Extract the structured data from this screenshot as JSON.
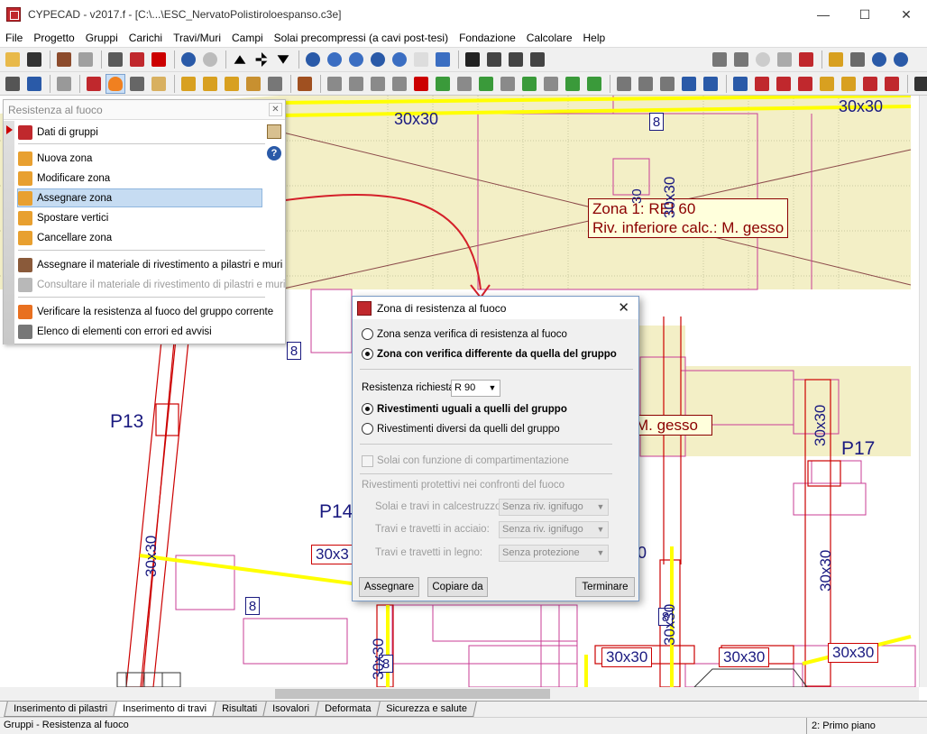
{
  "window": {
    "title": "CYPECAD - v2017.f - [C:\\...\\ESC_NervatoPolistiroloespanso.c3e]",
    "minimize": "—",
    "maximize": "☐",
    "close": "✕"
  },
  "menu": [
    "File",
    "Progetto",
    "Gruppi",
    "Carichi",
    "Travi/Muri",
    "Campi",
    "Solai precompressi (a cavi post-tesi)",
    "Fondazione",
    "Calcolare",
    "Help"
  ],
  "panel": {
    "title": "Resistenza al fuoco",
    "close": "✕",
    "items": [
      {
        "label": "Dati di gruppi"
      },
      {
        "label": "Nuova zona"
      },
      {
        "label": "Modificare zona"
      },
      {
        "label": "Assegnare zona"
      },
      {
        "label": "Spostare vertici"
      },
      {
        "label": "Cancellare zona"
      },
      {
        "label": "Assegnare il materiale di rivestimento a pilastri e muri"
      },
      {
        "label": "Consultare il materiale di rivestimento di pilastri e muri"
      },
      {
        "label": "Verificare la resistenza al fuoco del gruppo corrente"
      },
      {
        "label": "Elenco di elementi con errori ed avvisi"
      }
    ],
    "help": "?"
  },
  "dialog": {
    "title": "Zona di resistenza al fuoco",
    "close": "✕",
    "opt_no_check": "Zona senza verifica di resistenza al fuoco",
    "opt_diff_check": "Zona con verifica differente da quella del gruppo",
    "required_label": "Resistenza richiesta",
    "required_value": "R 90",
    "coat_same": "Rivestimenti uguali a quelli del gruppo",
    "coat_diff": "Rivestimenti diversi da quelli del gruppo",
    "compart": "Solai con funzione di compartimentazione",
    "protective_title": "Rivestimenti protettivi nei confronti del fuoco",
    "rows": [
      {
        "label": "Solai e travi in calcestruzzo:",
        "value": "Senza riv. ignifugo"
      },
      {
        "label": "Travi e travetti in acciaio:",
        "value": "Senza riv. ignifugo"
      },
      {
        "label": "Travi e travetti in legno:",
        "value": "Senza protezione"
      }
    ],
    "btn_assign": "Assegnare",
    "btn_copy": "Copiare da",
    "btn_end": "Terminare"
  },
  "canvas": {
    "zone_tag_line1": "Zona 1: REI 60",
    "zone_tag_line2": "Riv. inferiore calc.: M. gesso",
    "zone_tag_partial": "M. gesso",
    "beam_30x30": "30x30",
    "beam_30x3": "30x3",
    "num_8": "8",
    "num_0": "0",
    "p13": "P13",
    "p14": "P14",
    "p17": "P17",
    "v_30x30": "30x30",
    "v_30": "30"
  },
  "tabs": [
    "Inserimento di pilastri",
    "Inserimento di travi",
    "Risultati",
    "Isovalori",
    "Deformata",
    "Sicurezza e salute"
  ],
  "status": {
    "left": "Gruppi - Resistenza al fuoco",
    "right": "2: Primo piano"
  },
  "colors": {
    "slab": "#f3efc6",
    "beam_yellow": "#ffff00",
    "beam_red": "#cc0000",
    "magenta": "#c83c96",
    "accent_selected": "#c6dcf2"
  }
}
